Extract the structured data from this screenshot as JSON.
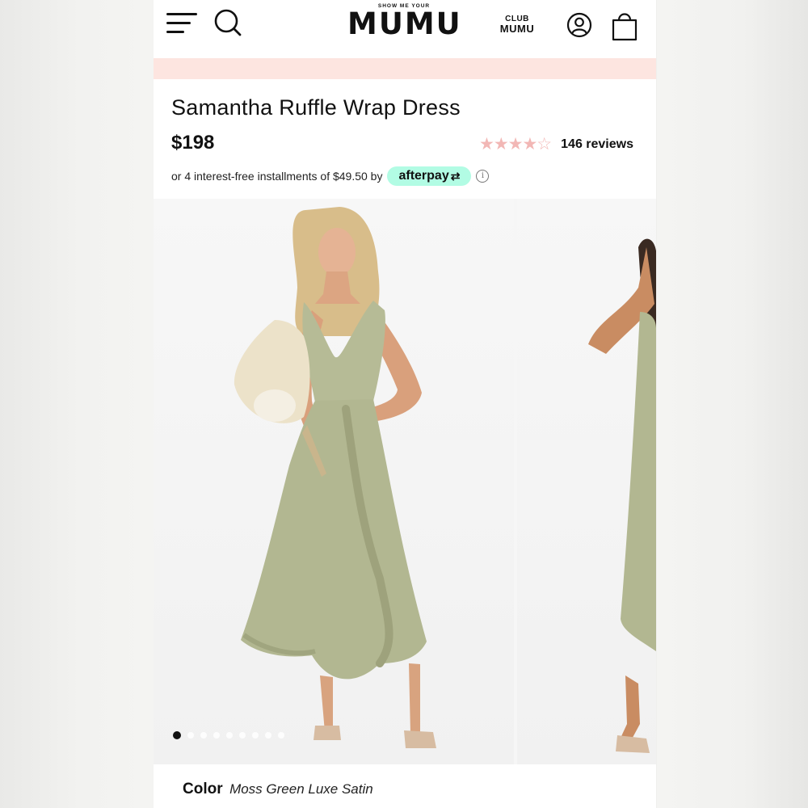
{
  "header": {
    "logo_small": "SHOW ME YOUR",
    "logo_main": "MUMU",
    "club_top": "CLUB",
    "club_main": "MUMU"
  },
  "product": {
    "title": "Samantha Ruffle Wrap Dress",
    "price": "$198",
    "rating": 4,
    "rating_max": 5,
    "stars_text": "★★★★☆",
    "reviews_label": "146 reviews",
    "installments_text": "or 4 interest-free installments of $49.50 by",
    "afterpay_label": "afterpay",
    "afterpay_icon": "⇄",
    "info_glyph": "i"
  },
  "gallery": {
    "slide_count": 9,
    "active_slide": 1
  },
  "color": {
    "label": "Color",
    "value": "Moss Green Luxe Satin"
  },
  "colors": {
    "dress": "#b6bb96",
    "promo_bar": "#fde5e0",
    "afterpay_mint": "#b2fce4",
    "star": "#f2b7b5"
  }
}
